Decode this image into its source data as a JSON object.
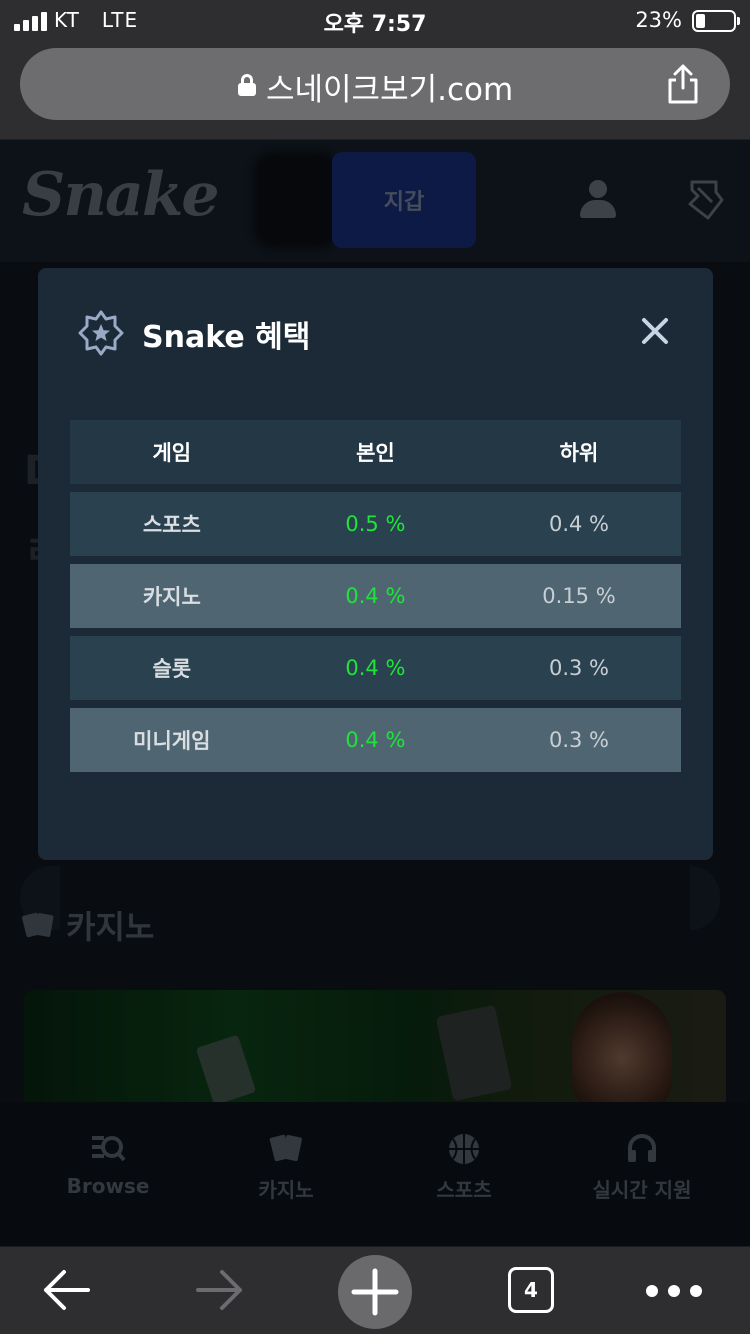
{
  "status_bar": {
    "carrier": "KT",
    "network": "LTE",
    "time": "오후 7:57",
    "battery": "23%"
  },
  "browser": {
    "url": "스네이크보기.com",
    "tab_count": "4"
  },
  "site": {
    "logo": "Snake",
    "wallet_label": "지갑",
    "casino_heading": "카지노"
  },
  "bottom_nav": [
    {
      "label": "Browse",
      "icon": "browse-icon"
    },
    {
      "label": "카지노",
      "icon": "cards-icon"
    },
    {
      "label": "스포츠",
      "icon": "basketball-icon"
    },
    {
      "label": "실시간 지원",
      "icon": "headset-icon"
    }
  ],
  "modal": {
    "title": "Snake 혜택",
    "columns": [
      "게임",
      "본인",
      "하위"
    ],
    "rows": [
      {
        "game": "스포츠",
        "self": "0.5 %",
        "sub": "0.4 %"
      },
      {
        "game": "카지노",
        "self": "0.4 %",
        "sub": "0.15 %"
      },
      {
        "game": "슬롯",
        "self": "0.4 %",
        "sub": "0.3 %"
      },
      {
        "game": "미니게임",
        "self": "0.4 %",
        "sub": "0.3 %"
      }
    ]
  },
  "colors": {
    "accent_green": "#20e33a",
    "modal_bg": "#1b2a36",
    "wallet_blue": "#14286a"
  }
}
